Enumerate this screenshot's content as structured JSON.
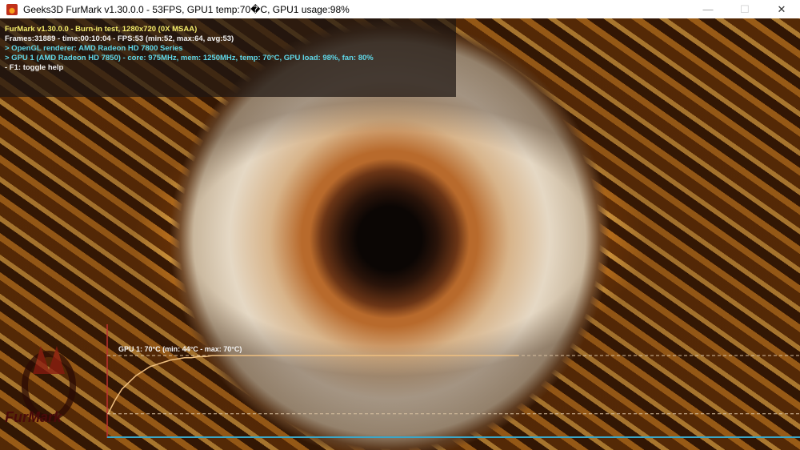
{
  "window": {
    "title": "Geeks3D FurMark v1.30.0.0 - 53FPS, GPU1 temp:70�C, GPU1 usage:98%",
    "minimize": "—",
    "maximize": "☐",
    "close": "✕"
  },
  "hud": {
    "line1": "FurMark v1.30.0.0 - Burn-in test, 1280x720 (0X MSAA)",
    "line2": "Frames:31889 - time:00:10:04 - FPS:53 (min:52, max:64, avg:53)",
    "line3": "> OpenGL renderer: AMD Radeon HD 7800 Series",
    "line4": "> GPU 1 (AMD Radeon HD 7850) - core: 975MHz, mem: 1250MHz, temp: 70°C, GPU load: 98%, fan: 80%",
    "line5": "- F1: toggle help"
  },
  "logo": {
    "text": "FurMark"
  },
  "chart_data": {
    "type": "line",
    "title": "GPU 1: 70°C (min: 44°C - max: 70°C)",
    "series": [
      {
        "name": "GPU 1 temperature",
        "values": [
          44,
          50,
          55,
          58,
          61,
          63,
          65,
          66,
          67,
          68,
          68.5,
          69,
          69,
          69.5,
          69.5,
          70,
          70,
          70,
          70,
          70,
          70,
          70,
          70,
          70,
          70,
          70,
          70,
          70,
          70,
          70,
          70,
          70,
          70,
          70,
          70,
          70,
          70,
          70,
          70,
          70,
          70,
          70,
          70,
          70,
          70,
          70,
          70,
          70,
          70,
          70,
          70,
          70,
          70,
          70,
          70,
          70,
          70,
          70,
          70,
          70
        ]
      }
    ],
    "min": 44,
    "max": 70,
    "ylim": [
      30,
      80
    ],
    "colors": {
      "line": "#f0c080",
      "axis_y": "#c03030",
      "axis_x": "#3aa6c8",
      "dashed": "#d8c0a0"
    }
  }
}
